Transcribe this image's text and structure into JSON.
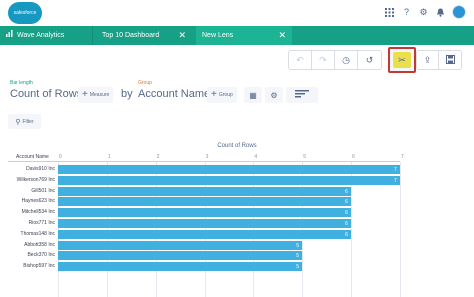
{
  "header": {
    "logo_text": "salesforce",
    "icons": [
      "apps-grid-icon",
      "help-icon",
      "gear-icon",
      "bell-icon",
      "avatar"
    ]
  },
  "tabs": [
    {
      "label": "Wave Analytics",
      "icon": "chart-icon",
      "active": false
    },
    {
      "label": "Top 10 Dashboard",
      "active": false,
      "closable": true
    },
    {
      "label": "New Lens",
      "active": true,
      "closable": true
    }
  ],
  "toolbar": {
    "group1": [
      "undo-icon",
      "redo-icon",
      "clock-icon",
      "reset-icon"
    ],
    "highlighted": "scissors-icon",
    "group2": [
      "share-icon",
      "save-icon"
    ]
  },
  "query": {
    "bar_length_label": "Bar length",
    "bar_length_value": "Count of Rows",
    "measure_button": "Measure",
    "by_text": "by",
    "group_label": "Group",
    "group_value": "Account Name",
    "group_button": "Group",
    "filter_button": "Filter"
  },
  "colors": {
    "tab_bar": "#16a085",
    "bar": "#3fb0df",
    "highlight": "#c23934",
    "bar_length_label": "#16a085",
    "group_label": "#e07b2a"
  },
  "chart_data": {
    "type": "bar",
    "orientation": "horizontal",
    "title": "Count of Rows",
    "ylabel": "Account Name",
    "xlim": [
      0,
      7
    ],
    "xticks": [
      "0",
      "1",
      "2",
      "3",
      "4",
      "5",
      "6",
      "7"
    ],
    "categories": [
      "Davis910 Inc",
      "Wilkerson769 Inc",
      "Gill501 Inc",
      "Haynes623 Inc",
      "Mitchell534 Inc",
      "Rios771 Inc",
      "Thomas148 Inc",
      "Abbott358 Inc",
      "Beck370 Inc",
      "Bishop597 Inc"
    ],
    "values": [
      7,
      7,
      6,
      6,
      6,
      6,
      6,
      5,
      5,
      5
    ]
  }
}
